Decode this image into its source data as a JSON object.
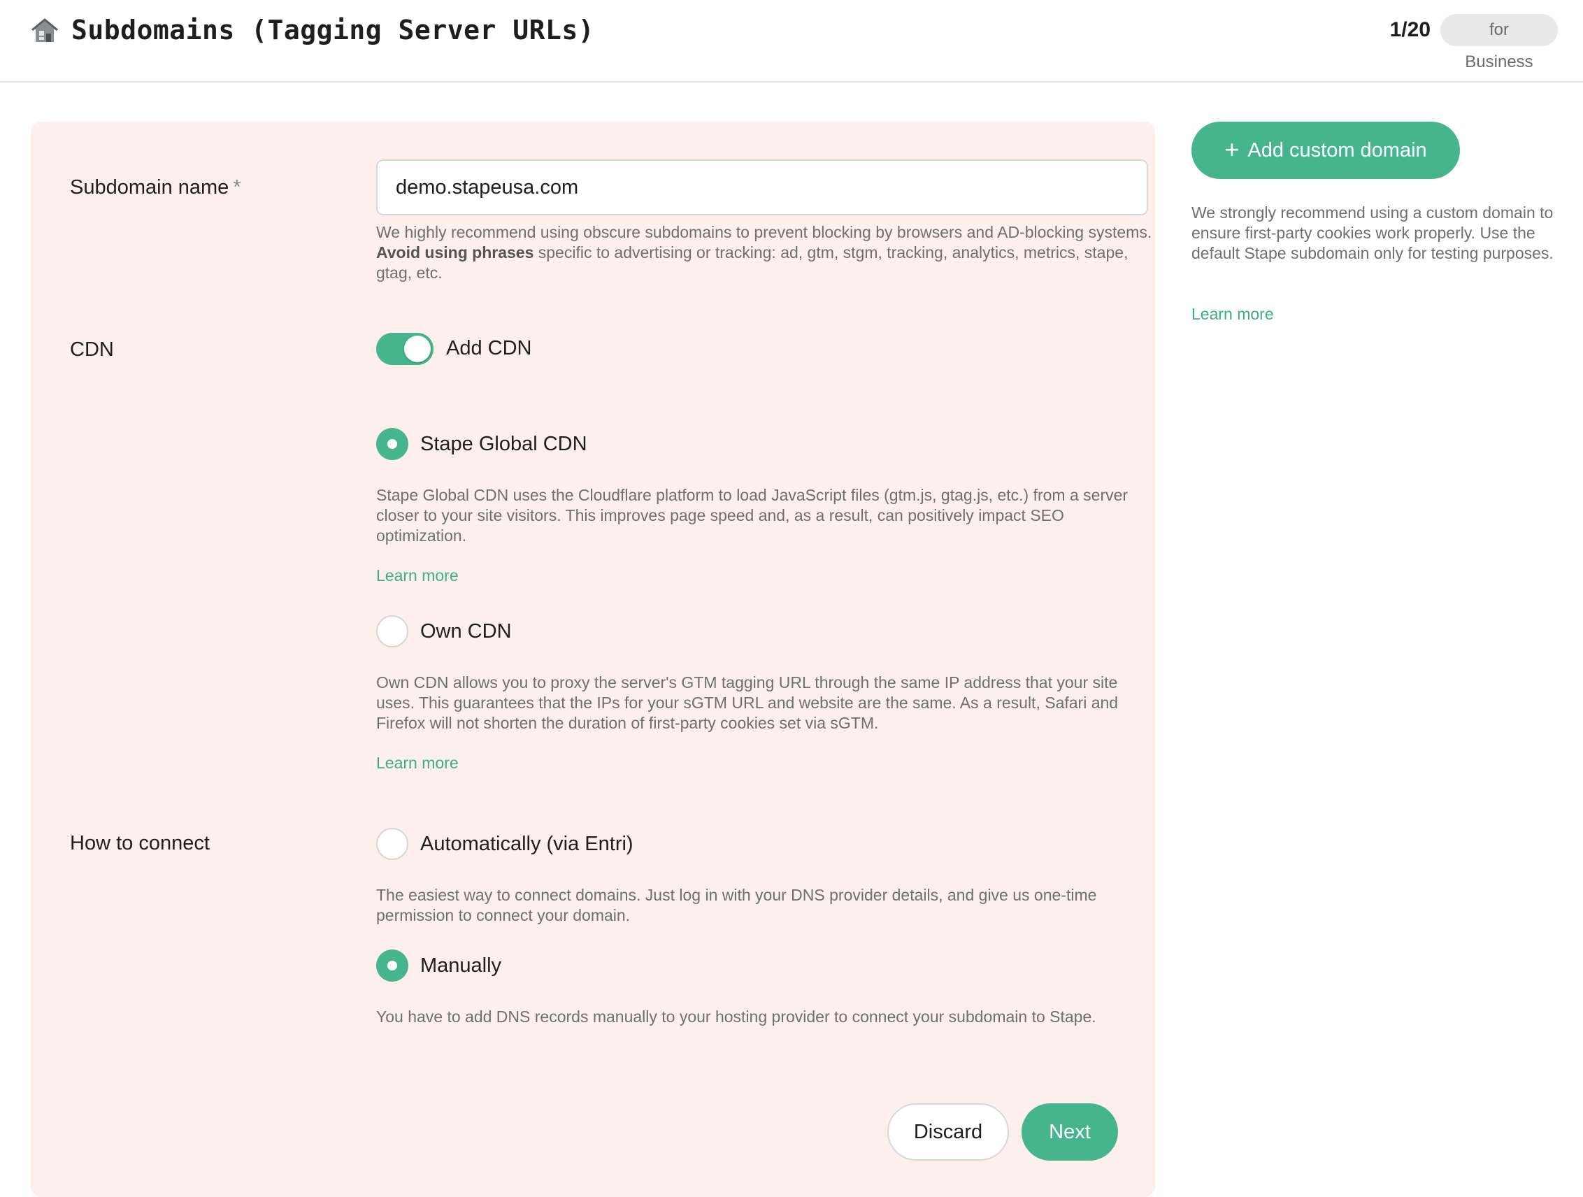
{
  "header": {
    "title": "Subdomains (Tagging Server URLs)",
    "counter": "1/20",
    "plan_badge": "for Business"
  },
  "form": {
    "subdomain": {
      "label": "Subdomain name",
      "required_mark": "*",
      "value": "demo.stapeusa.com",
      "helper_before": "We highly recommend using obscure subdomains to prevent blocking by browsers and AD-blocking systems. ",
      "helper_bold": "Avoid using phrases",
      "helper_after": " specific to advertising or tracking: ad, gtm, stgm, tracking, analytics, metrics, stape, gtag, etc."
    },
    "cdn": {
      "label": "CDN",
      "toggle_label": "Add CDN",
      "toggle_on": true,
      "options": [
        {
          "label": "Stape Global CDN",
          "checked": true,
          "description": "Stape Global CDN uses the Cloudflare platform to load JavaScript files (gtm.js, gtag.js, etc.) from a server closer to your site visitors. This improves page speed and, as a result, can positively impact SEO optimization.",
          "link": "Learn more"
        },
        {
          "label": "Own CDN",
          "checked": false,
          "description": "Own CDN allows you to proxy the server's GTM tagging URL through the same IP address that your site uses. This guarantees that the IPs for your sGTM URL and website are the same. As a result, Safari and Firefox will not shorten the duration of first-party cookies set via sGTM.",
          "link": "Learn more"
        }
      ]
    },
    "connect": {
      "label": "How to connect",
      "options": [
        {
          "label": "Automatically (via Entri)",
          "checked": false,
          "description": "The easiest way to connect domains. Just log in with your DNS provider details, and give us one-time permission to connect your domain."
        },
        {
          "label": "Manually",
          "checked": true,
          "description": "You have to add DNS records manually to your hosting provider to connect your subdomain to Stape."
        }
      ]
    },
    "actions": {
      "discard_label": "Discard",
      "next_label": "Next"
    }
  },
  "sidebar": {
    "add_button_label": "Add custom domain",
    "add_button_icon": "plus-icon",
    "text": "We strongly recommend using a custom domain to ensure first-party cookies work properly. Use the default Stape subdomain only for testing purposes.",
    "link": "Learn more"
  },
  "colors": {
    "accent": "#46b58d",
    "card_bg": "#fdefeb",
    "link": "#3daf87"
  }
}
